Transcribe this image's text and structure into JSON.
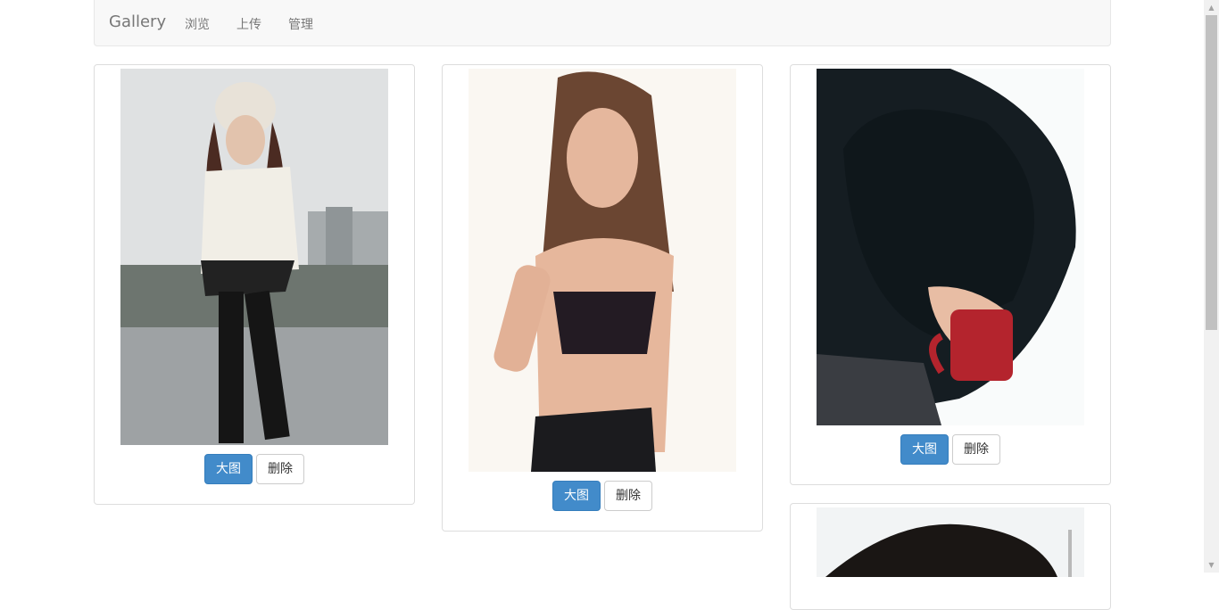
{
  "navbar": {
    "brand": "Gallery",
    "links": [
      "浏览",
      "上传",
      "管理"
    ]
  },
  "cards": [
    {
      "photo": "woman-in-winter-coat-photo",
      "view_label": "大图",
      "delete_label": "删除"
    },
    {
      "photo": "woman-portrait-photo",
      "view_label": "大图",
      "delete_label": "删除"
    },
    {
      "photo": "woman-with-red-cup-photo",
      "view_label": "大图",
      "delete_label": "删除"
    },
    {
      "photo": "woman-partial-photo"
    }
  ],
  "colors": {
    "primary": "#428bca",
    "navbar_bg": "#f8f8f8",
    "border": "#dddddd"
  }
}
